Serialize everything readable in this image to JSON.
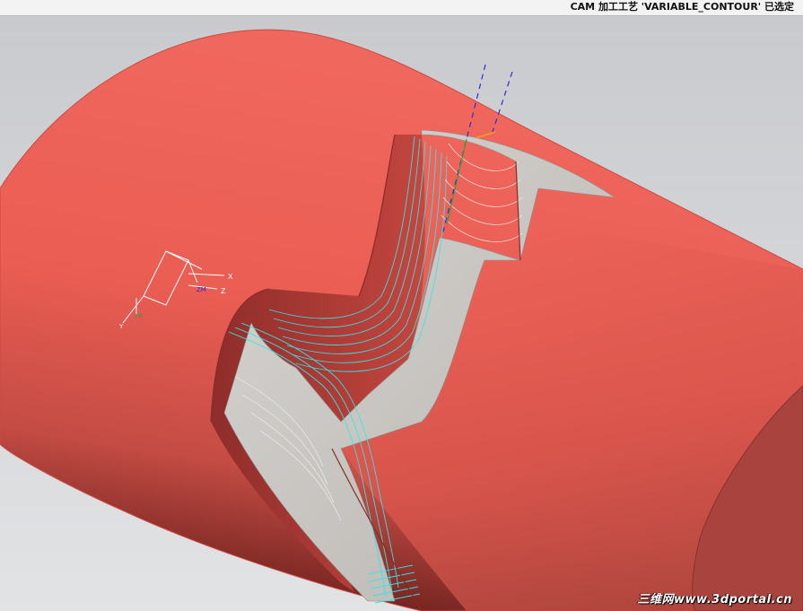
{
  "status_bar": {
    "message": "CAM 加工工艺 'VARIABLE_CONTOUR' 已选定"
  },
  "viewport": {
    "name": "graphics-window",
    "background_color": "#d0d1d4",
    "part_color": "#e8584f",
    "toolpath_color": "#34e6e6"
  },
  "csys": {
    "x_label": "X",
    "zm_label": "ZM",
    "z_label": "Z",
    "ym_label": "YM",
    "y_label": "Y"
  },
  "watermark": {
    "text": "三维网www.3dportal.cn"
  }
}
